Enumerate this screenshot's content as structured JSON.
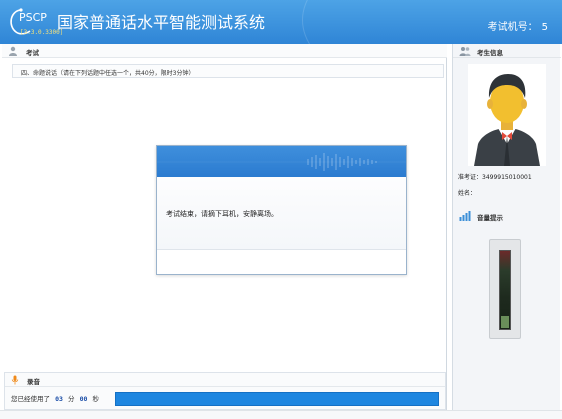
{
  "header": {
    "logo_text": "PSCP",
    "title": "国家普通话水平智能测试系统",
    "version": "[3.3.0.3300]",
    "machine_label": "考试机号：",
    "machine_number": "5"
  },
  "exam_section": {
    "label": "考试",
    "question_text": "四、命题说话（请在下列话题中任选一个，共40分，限时3分钟）"
  },
  "dialog": {
    "message": "考试结束，请摘下耳机，安静离场。"
  },
  "recording": {
    "label": "录音",
    "used_prefix": "您已经使用了",
    "minutes": "03",
    "minute_unit": "分",
    "seconds": "00",
    "second_unit": "秒",
    "progress": 1.0
  },
  "candidate": {
    "label": "考生信息",
    "ticket_label": "准考证：",
    "ticket_number": "3499915010001",
    "name_label": "姓名：",
    "name_value": ""
  },
  "volume": {
    "label": "音量提示",
    "level": 0.15
  },
  "colors": {
    "header_blue": "#2f85d6",
    "progress_blue": "#1e86e0",
    "version_yellow": "#f6e27a"
  }
}
